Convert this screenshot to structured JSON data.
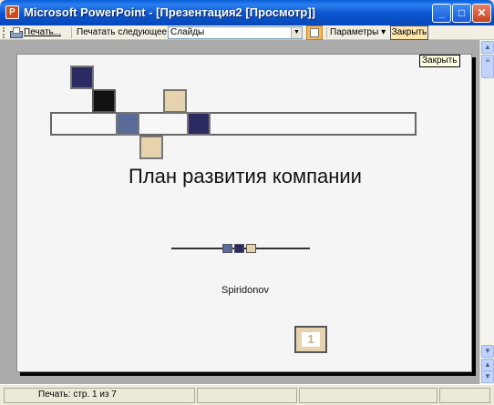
{
  "window": {
    "app_icon": "powerpoint-icon",
    "title": "Microsoft PowerPoint - [Презентация2 [Просмотр]]",
    "buttons": {
      "minimize": "_",
      "maximize": "□",
      "close": "✕"
    }
  },
  "toolbar": {
    "print_label": "Печать...",
    "print_next_label": "Печатать следующее:",
    "print_what_value": "Слайды",
    "options_label": "Параметры ▾",
    "close_label": "Закрыть"
  },
  "tooltip": {
    "text": "Закрыть"
  },
  "slide": {
    "title": "План развития компании",
    "subtitle": "Spiridonov",
    "number": "1"
  },
  "status": {
    "page_text": "Печать: стр. 1 из 7"
  },
  "colors": {
    "navy": "#2b2a63",
    "tan": "#e6d3ad",
    "slate": "#5a6b98",
    "titlebar": "#0b54d0"
  }
}
